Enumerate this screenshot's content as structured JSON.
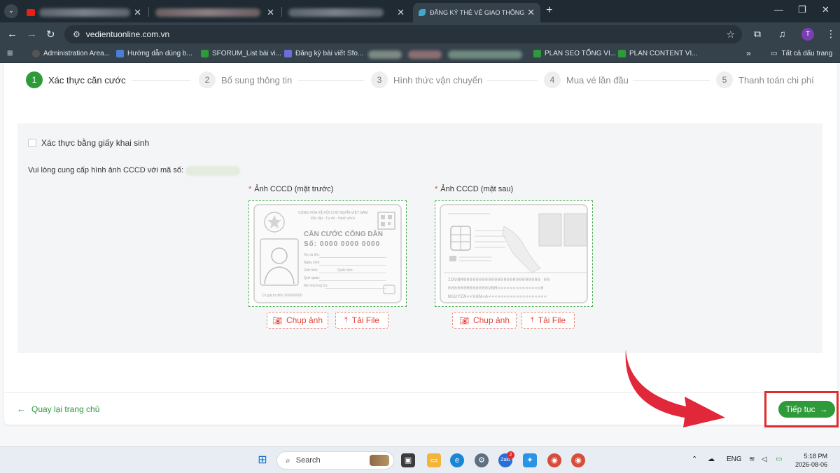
{
  "browser": {
    "tabs": [
      {
        "title": ""
      },
      {
        "title": ""
      },
      {
        "title": ""
      },
      {
        "title": "ĐĂNG KÝ THẺ VÉ GIAO THÔNG"
      }
    ],
    "url": "vedientuonline.com.vn",
    "profile_initial": "T",
    "bookmarks": [
      {
        "label": "Administration Area..."
      },
      {
        "label": "Hướng dẫn dùng b..."
      },
      {
        "label": "SFORUM_List bài vi..."
      },
      {
        "label": "Đăng ký bài viết Sfo..."
      },
      {
        "label": "PLAN SEO TỔNG VI..."
      },
      {
        "label": "PLAN CONTENT VI..."
      }
    ],
    "bookmarks_overflow": "»",
    "all_bookmarks": "Tất cả dấu trang"
  },
  "steps": [
    {
      "num": "1",
      "label": "Xác thực căn cước"
    },
    {
      "num": "2",
      "label": "Bổ sung thông tin"
    },
    {
      "num": "3",
      "label": "Hình thức vận chuyển"
    },
    {
      "num": "4",
      "label": "Mua vé lần đầu"
    },
    {
      "num": "5",
      "label": "Thanh toán chi phí"
    }
  ],
  "form": {
    "birth_cert_checkbox": "Xác thực bằng giấy khai sinh",
    "prompt": "Vui lòng cung cấp hình ảnh CCCD với mã số:",
    "front_label": "Ảnh CCCD (mặt trước)",
    "back_label": "Ảnh CCCD (mặt sau)",
    "required_mark": "*",
    "capture_button": "Chụp ảnh",
    "upload_button": "Tải File"
  },
  "id_front": {
    "header_1": "CỘNG HÒA XÃ HỘI CHỦ NGHĨA VIỆT NAM",
    "header_2": "Độc lập - Tự do - Hạnh phúc",
    "title": "CĂN CƯỚC CÔNG DÂN",
    "number": "Số: 0000 0000 0000",
    "field_name": "Họ và tên:",
    "field_dob": "Ngày sinh:",
    "field_sex": "Giới tính:",
    "field_nationality": "Quốc tịch:",
    "field_hometown": "Quê quán:",
    "field_residence": "Nơi thường trú:",
    "expiry": "Có giá trị đến: 00/00/0000"
  },
  "id_back": {
    "mrz_1": "IDVNM0000000000000000000000000 00",
    "mrz_2": "000000M000000VNM<<<<<<<<<<<<<<0",
    "mrz_3": "NGUYEN<<VAN<A<<<<<<<<<<<<<<<<<<<"
  },
  "footer": {
    "back_label": "Quay lại trang chủ",
    "next_label": "Tiếp tục"
  },
  "taskbar": {
    "search_label": "Search",
    "teams_badge": "2",
    "language": "ENG",
    "time": "5:18 PM",
    "date": "2026-08-06"
  },
  "colors": {
    "brand_green": "#2e9a3a",
    "required_red": "#e0453c",
    "annotation_red": "#e02c2c"
  }
}
